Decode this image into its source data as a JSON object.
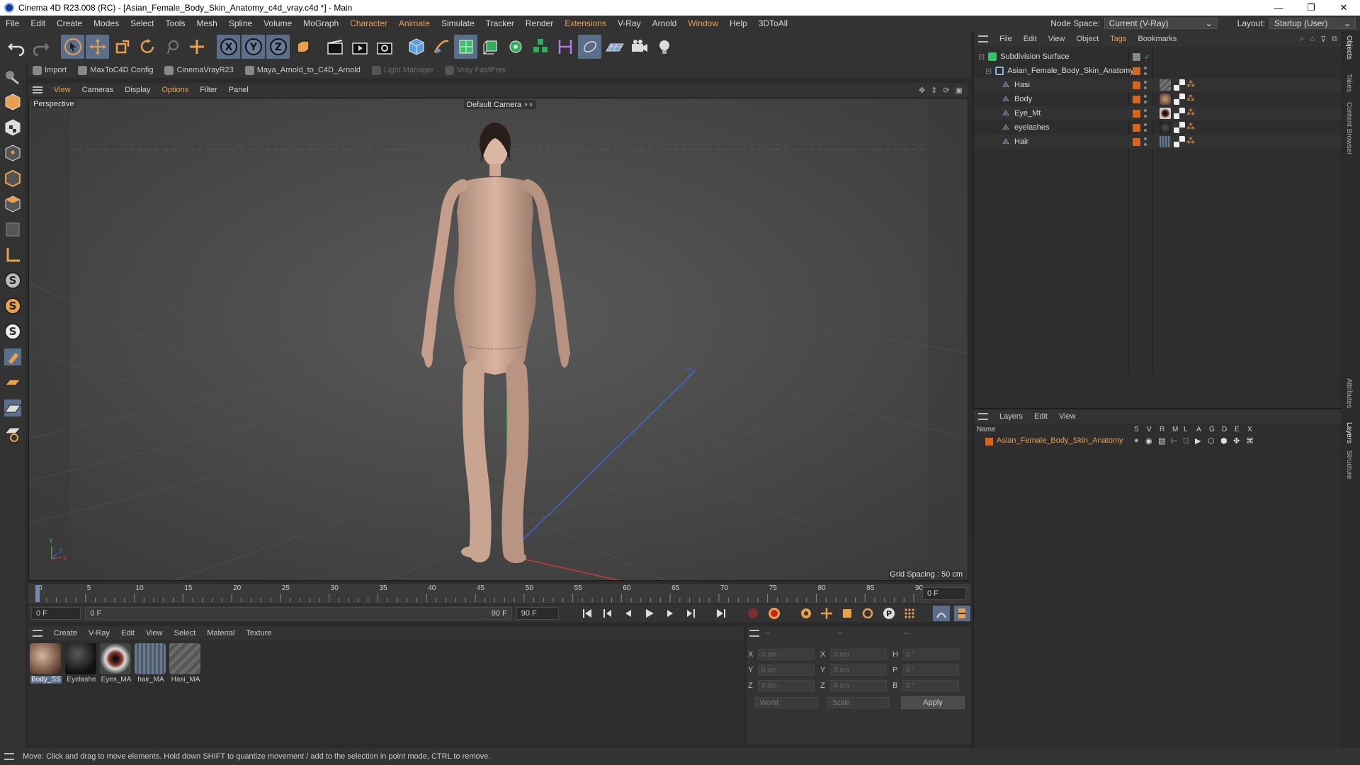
{
  "window": {
    "title": "Cinema 4D R23.008 (RC) - [Asian_Female_Body_Skin_Anatomy_c4d_vray.c4d *] - Main",
    "min": "—",
    "max": "❐",
    "close": "✕"
  },
  "menubar": {
    "items": [
      "File",
      "Edit",
      "Create",
      "Modes",
      "Select",
      "Tools",
      "Mesh",
      "Spline",
      "Volume",
      "MoGraph",
      "Character",
      "Animate",
      "Simulate",
      "Tracker",
      "Render",
      "Extensions",
      "V-Ray",
      "Arnold",
      "Window",
      "Help",
      "3DToAll"
    ],
    "node_space_label": "Node Space:",
    "node_space_value": "Current (V-Ray)",
    "layout_label": "Layout:",
    "layout_value": "Startup (User)"
  },
  "plugins": {
    "items": [
      "Import",
      "MaxToC4D Config",
      "CinemaVrayR23",
      "Maya_Arnold_to_C4D_Arnold",
      "Light Manager",
      "Vray FastPrev"
    ]
  },
  "viewport": {
    "menu": [
      "View",
      "Cameras",
      "Display",
      "Options",
      "Filter",
      "Panel"
    ],
    "label": "Perspective",
    "camera": "Default Camera",
    "grid_spacing": "Grid Spacing : 50 cm",
    "axis_y": "Y",
    "axis_x": "X",
    "axis_z": "Z"
  },
  "timeline": {
    "ticks": [
      "0",
      "5",
      "10",
      "15",
      "20",
      "25",
      "30",
      "35",
      "40",
      "45",
      "50",
      "55",
      "60",
      "65",
      "70",
      "75",
      "80",
      "85",
      "90"
    ],
    "current_frame": "0 F",
    "start": "0 F",
    "range_start": "0 F",
    "range_end": "90 F",
    "end": "90 F"
  },
  "materials": {
    "menu": [
      "Create",
      "V-Ray",
      "Edit",
      "View",
      "Select",
      "Material",
      "Texture"
    ],
    "items": [
      "Body_SS",
      "Eyelashe",
      "Eyes_MA",
      "hair_MA",
      "Hasi_MA"
    ]
  },
  "attributes": {
    "dash": "--",
    "x_label": "X",
    "y_label": "Y",
    "z_label": "Z",
    "h_label": "H",
    "p_label": "P",
    "b_label": "B",
    "pos": "0 cm",
    "angle": "0 °",
    "coord_mode": "World",
    "size_mode": "Scale",
    "apply": "Apply"
  },
  "object_manager": {
    "menu": [
      "File",
      "Edit",
      "View",
      "Object",
      "Tags",
      "Bookmarks"
    ],
    "objects": [
      "Subdivision Surface",
      "Asian_Female_Body_Skin_Anatomy",
      "Hasi",
      "Body",
      "Eye_Mt",
      "eyelashes",
      "Hair"
    ]
  },
  "layers": {
    "menu": [
      "Layers",
      "Edit",
      "View"
    ],
    "columns": [
      "Name",
      "S",
      "V",
      "R",
      "M",
      "L",
      "A",
      "G",
      "D",
      "E",
      "X"
    ],
    "row": "Asian_Female_Body_Skin_Anatomy",
    "layer_color": "#d6661e"
  },
  "sidetabs": [
    "Objects",
    "Takes",
    "Content Browser",
    "Attributes",
    "Layers",
    "Structure"
  ],
  "status": "Move: Click and drag to move elements. Hold down SHIFT to quantize movement / add to the selection in point mode, CTRL to remove.",
  "colors": {
    "accent": "#e8a050",
    "selection": "#5b6e8a"
  }
}
